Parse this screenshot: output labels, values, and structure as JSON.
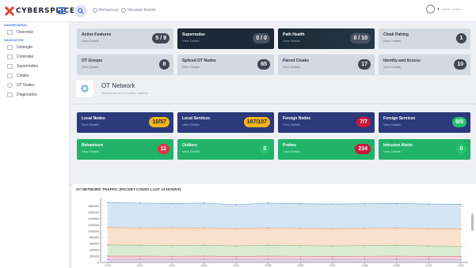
{
  "app": {
    "logo_text": "CYBERSPLICE",
    "colors": {
      "accent": "#4a77d6",
      "dark_card": "#1c2838",
      "navy_card": "#2c3a7c",
      "green_card": "#22b36a",
      "light_card": "#d3d9e1"
    }
  },
  "topbar": {
    "links": [
      {
        "label": "Behaviours",
        "icon": "behaviours-icon"
      },
      {
        "label": "Intrusion Events",
        "icon": "intrusion-events-icon"
      }
    ],
    "user_name": "admin · admin"
  },
  "sidebar": {
    "dashboards_title": "DASHBOARDS",
    "navigation_title": "NAVIGATION",
    "dashboards": [
      {
        "label": "Overview",
        "icon": "home-icon"
      }
    ],
    "items": [
      {
        "label": "Untangle",
        "icon": "untangle-icon"
      },
      {
        "label": "Controller",
        "icon": "controller-icon"
      },
      {
        "label": "Supernodes",
        "icon": "supernodes-icon"
      },
      {
        "label": "Cloaks",
        "icon": "cloaks-icon"
      },
      {
        "label": "OT Nodes",
        "icon": "ot-nodes-icon"
      },
      {
        "label": "Diagnostics",
        "icon": "diagnostics-icon"
      }
    ]
  },
  "row1": [
    {
      "title": "Active Features",
      "sub": "View Details",
      "value": "5 / 9",
      "style": "light"
    },
    {
      "title": "Supernodes",
      "sub": "View Details",
      "value": "0 / 0",
      "style": "dark"
    },
    {
      "title": "Path Health",
      "sub": "View Details",
      "value": "0 / 10",
      "style": "dark"
    },
    {
      "title": "Cloak Pairing",
      "sub": "View Details",
      "value": "1",
      "style": "light"
    }
  ],
  "row2": [
    {
      "title": "OT Groups",
      "sub": "View Details",
      "value": "8",
      "style": "light"
    },
    {
      "title": "Spliced OT Nodes",
      "sub": "View Details",
      "value": "65",
      "style": "light"
    },
    {
      "title": "Paired Cloaks",
      "sub": "View Details",
      "value": "17",
      "style": "light"
    },
    {
      "title": "Identity and Access",
      "sub": "View Details",
      "value": "10",
      "style": "light"
    }
  ],
  "section": {
    "title": "OT Network",
    "subtitle": "Behaviours and Security Visibility"
  },
  "row3": [
    {
      "title": "Local Nodes",
      "sub": "View Details",
      "value": "10/57",
      "badge": "yellow"
    },
    {
      "title": "Local Services",
      "sub": "View Details",
      "value": "107/107",
      "badge": "yellow"
    },
    {
      "title": "Foreign Nodes",
      "sub": "View Details",
      "value": "7/7",
      "badge": "crimson"
    },
    {
      "title": "Foreign Services",
      "sub": "View Details",
      "value": "0/0",
      "badge": "green"
    }
  ],
  "row4": [
    {
      "title": "Behaviours",
      "sub": "View Details",
      "value": "11",
      "badge": "red"
    },
    {
      "title": "Outliers",
      "sub": "View Details",
      "value": "0",
      "badge": "green"
    },
    {
      "title": "Probes",
      "sub": "View Details",
      "value": "234",
      "badge": "crimson"
    },
    {
      "title": "Intrusion Alerts",
      "sub": "View Details",
      "value": "0",
      "badge": "green"
    }
  ],
  "chart_data": {
    "type": "area",
    "title": "OT NETWORK TRAFFIC (PACKET COUNT LAST 12 HOURS)",
    "x": [
      "0:12",
      "0:01",
      "0:02",
      "0:03",
      "0:04",
      "0:05",
      "0:06",
      "0:07",
      "0:08",
      "0:09",
      "0:10",
      "0:11"
    ],
    "ylim": [
      0,
      2000000
    ],
    "yticks": [
      "1800000",
      "1600000",
      "1400000",
      "1200000",
      "1000000",
      "800000",
      "600000",
      "400000",
      "200000",
      "0"
    ],
    "grid": true,
    "series": [
      {
        "color": "#cfe2f3",
        "line": "#7ea8d8",
        "values": [
          1920000,
          1900000,
          1890000,
          1900000,
          1850000,
          1900000,
          1880000,
          1870000,
          1880000,
          1890000,
          1870000,
          1860000
        ]
      },
      {
        "color": "#fde0c9",
        "line": "#f4a66a",
        "values": [
          1120000,
          1100000,
          1110000,
          1100000,
          1080000,
          1100000,
          1090000,
          1080000,
          1090000,
          1100000,
          1080000,
          1070000
        ]
      },
      {
        "color": "#d6ecd2",
        "line": "#8cc487",
        "values": [
          560000,
          550000,
          540000,
          550000,
          530000,
          550000,
          540000,
          530000,
          540000,
          550000,
          530000,
          520000
        ]
      },
      {
        "color": "#f6d3d8",
        "line": "#e07b8c",
        "values": [
          200000,
          200000,
          195000,
          200000,
          190000,
          200000,
          195000,
          190000,
          195000,
          200000,
          190000,
          190000
        ]
      },
      {
        "color": "#e6d9f2",
        "line": "#a98bd0",
        "values": [
          100000,
          100000,
          100000,
          100000,
          100000,
          100000,
          100000,
          100000,
          100000,
          100000,
          100000,
          100000
        ]
      }
    ]
  }
}
